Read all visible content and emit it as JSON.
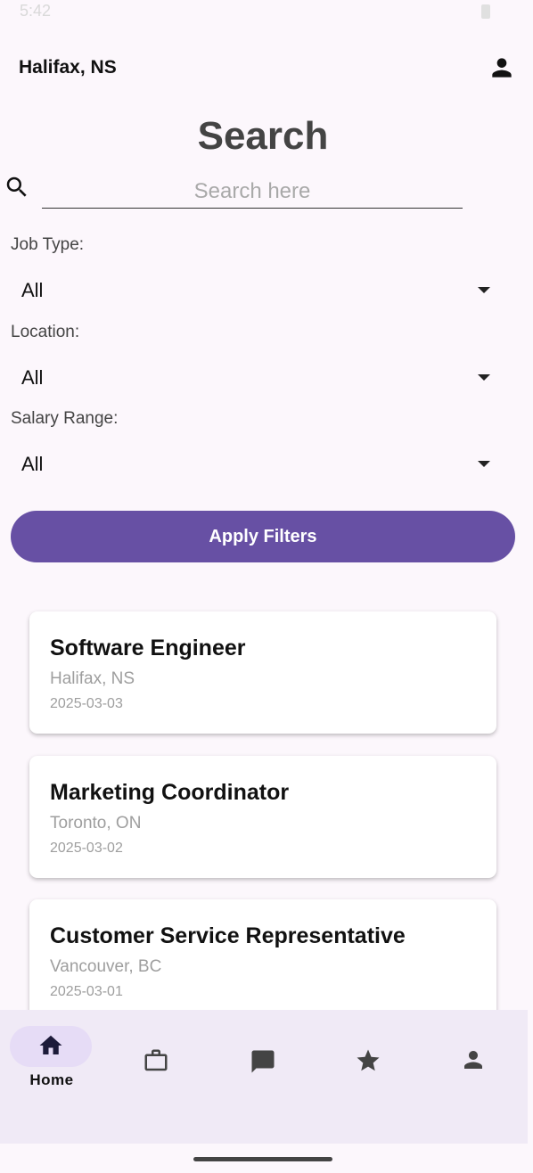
{
  "status_bar": {
    "time": "5:42"
  },
  "header": {
    "location": "Halifax, NS"
  },
  "search": {
    "title": "Search",
    "placeholder": "Search here",
    "value": ""
  },
  "filters": [
    {
      "label": "Job Type:",
      "value": "All"
    },
    {
      "label": "Location:",
      "value": "All"
    },
    {
      "label": "Salary Range:",
      "value": "All"
    }
  ],
  "apply_label": "Apply Filters",
  "jobs": [
    {
      "title": "Software Engineer",
      "location": "Halifax, NS",
      "date": "2025-03-03"
    },
    {
      "title": "Marketing Coordinator",
      "location": "Toronto, ON",
      "date": "2025-03-02"
    },
    {
      "title": "Customer Service Representative",
      "location": "Vancouver, BC",
      "date": "2025-03-01"
    }
  ],
  "nav": {
    "items": [
      {
        "icon": "home-icon",
        "label": "Home",
        "active": true
      },
      {
        "icon": "briefcase-icon",
        "label": ""
      },
      {
        "icon": "chat-icon",
        "label": ""
      },
      {
        "icon": "star-icon",
        "label": ""
      },
      {
        "icon": "person-icon",
        "label": ""
      }
    ]
  },
  "colors": {
    "accent": "#6750a4",
    "background": "#fcf7fc",
    "nav_background": "#f0eaf6",
    "nav_pill": "#e6dcf6"
  }
}
